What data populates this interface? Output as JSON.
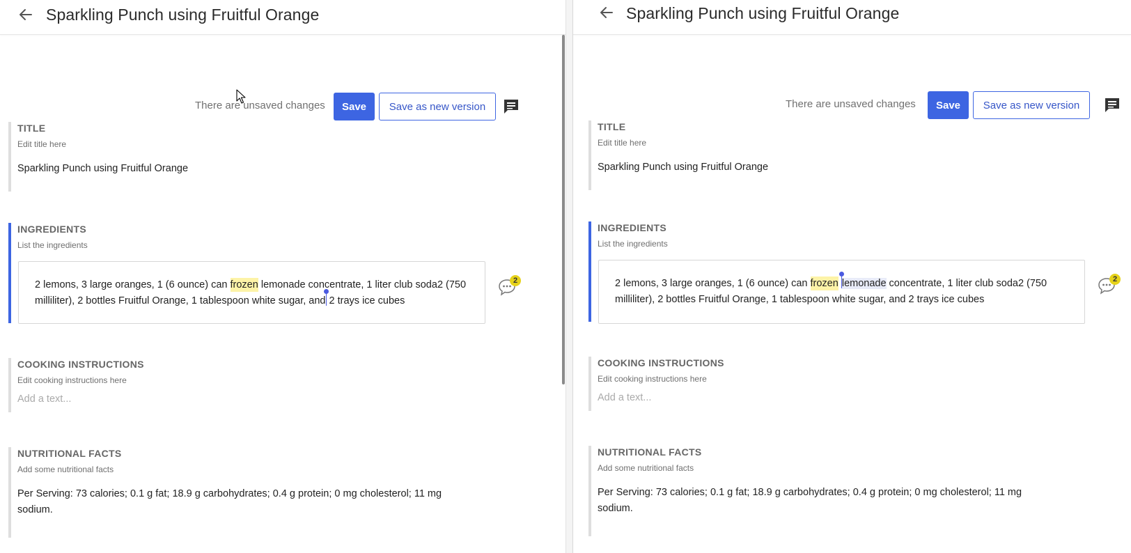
{
  "page": {
    "title": "Sparkling Punch using Fruitful Orange",
    "unsaved_text": "There are unsaved changes",
    "save_label": "Save",
    "save_version_label": "Save as new version"
  },
  "sections": {
    "title": {
      "heading": "TITLE",
      "description": "Edit title here",
      "value": "Sparkling Punch using Fruitful Orange"
    },
    "ingredients": {
      "heading": "INGREDIENTS",
      "description": "List the ingredients",
      "text_before": "2 lemons, 3 large oranges, 1 (6 ounce) can ",
      "highlighted_word": "frozen",
      "text_after": " lemonade concentrate, 1 liter club soda2 (750 milliliter), 2 bottles Fruitful Orange, 1 tablespoon white sugar, and 2 trays ice cubes",
      "comment_count": "2",
      "right_selected_word": "lemonade",
      "right_text_rest": " concentrate, 1 liter club soda2 (750 milliliter), 2 bottles Fruitful Orange, 1 tablespoon white sugar, and 2 trays ice cubes",
      "left_text_before_caret": " lemonade concentrate, 1 liter club soda2 (750 milliliter), 2 bottles Fruitful Orange, 1 tablespoon white sugar, and",
      "left_text_after_caret": " 2 trays ice cubes"
    },
    "cooking": {
      "heading": "COOKING INSTRUCTIONS",
      "description": "Edit cooking instructions here",
      "placeholder": "Add a text..."
    },
    "nutrition": {
      "heading": "NUTRITIONAL FACTS",
      "description": "Add some nutritional facts",
      "value": "Per Serving: 73 calories; 0.1 g fat; 18.9 g carbohydrates; 0.4 g protein; 0 mg cholesterol; 11 mg sodium."
    }
  },
  "icons": {
    "back": "arrow-left-icon",
    "comments": "comments-icon",
    "comment_bubble": "comment-bubble-icon",
    "cursor": "mouse-pointer-icon"
  },
  "colors": {
    "accent": "#3d65e2",
    "highlight": "#fdf3a7",
    "badge": "#e6d21a"
  }
}
